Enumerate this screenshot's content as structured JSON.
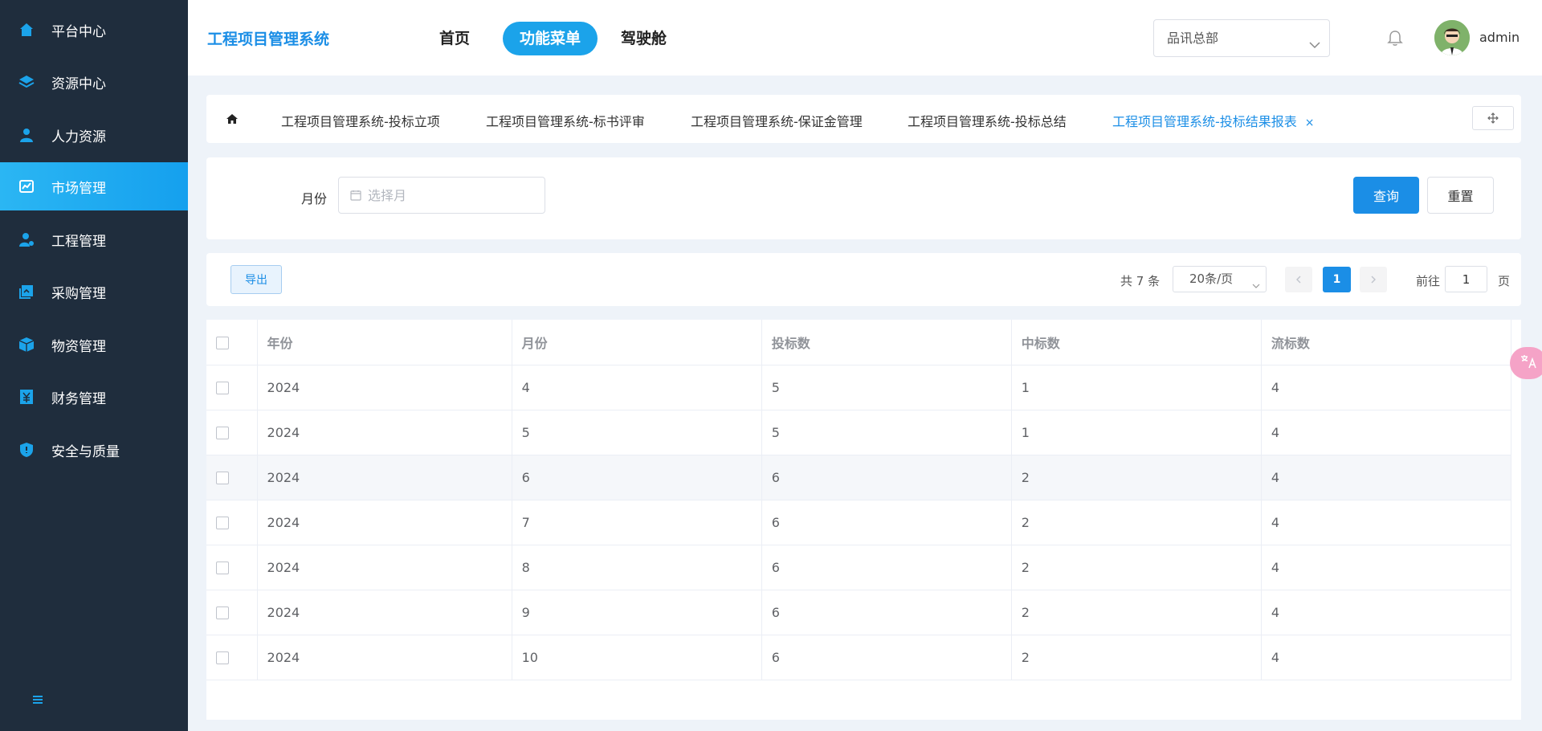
{
  "sidebar": {
    "items": [
      {
        "label": "平台中心",
        "icon": "home-icon"
      },
      {
        "label": "资源中心",
        "icon": "layers-icon"
      },
      {
        "label": "人力资源",
        "icon": "user-icon"
      },
      {
        "label": "市场管理",
        "icon": "chart-icon",
        "active": true
      },
      {
        "label": "工程管理",
        "icon": "engineer-icon"
      },
      {
        "label": "采购管理",
        "icon": "purchase-icon"
      },
      {
        "label": "物资管理",
        "icon": "box-icon"
      },
      {
        "label": "财务管理",
        "icon": "finance-icon"
      },
      {
        "label": "安全与质量",
        "icon": "shield-icon"
      }
    ],
    "collapse_icon": "menu-icon"
  },
  "header": {
    "title": "工程项目管理系统",
    "nav": [
      "首页",
      "功能菜单",
      "驾驶舱"
    ],
    "active_nav": "功能菜单",
    "org_select": "品讯总部",
    "username": "admin"
  },
  "tabs": {
    "items": [
      "工程项目管理系统-投标立项",
      "工程项目管理系统-标书评审",
      "工程项目管理系统-保证金管理",
      "工程项目管理系统-投标总结",
      "工程项目管理系统-投标结果报表"
    ],
    "active": "工程项目管理系统-投标结果报表",
    "close_glyph": "×"
  },
  "search": {
    "month_label": "月份",
    "month_placeholder": "选择月",
    "query_label": "查询",
    "reset_label": "重置"
  },
  "toolbar": {
    "export_label": "导出",
    "total_text": "共 7 条",
    "page_size": "20条/页",
    "current_page": "1",
    "goto_label": "前往",
    "goto_value": "1",
    "goto_unit": "页"
  },
  "table": {
    "columns": [
      "年份",
      "月份",
      "投标数",
      "中标数",
      "流标数"
    ],
    "rows": [
      [
        "2024",
        "4",
        "5",
        "1",
        "4"
      ],
      [
        "2024",
        "5",
        "5",
        "1",
        "4"
      ],
      [
        "2024",
        "6",
        "6",
        "2",
        "4"
      ],
      [
        "2024",
        "7",
        "6",
        "2",
        "4"
      ],
      [
        "2024",
        "8",
        "6",
        "2",
        "4"
      ],
      [
        "2024",
        "9",
        "6",
        "2",
        "4"
      ],
      [
        "2024",
        "10",
        "6",
        "2",
        "4"
      ]
    ]
  },
  "colors": {
    "sidebar_bg": "#1f2d3d",
    "accent": "#1b8ee6",
    "active_nav": "#1ba3ea"
  }
}
